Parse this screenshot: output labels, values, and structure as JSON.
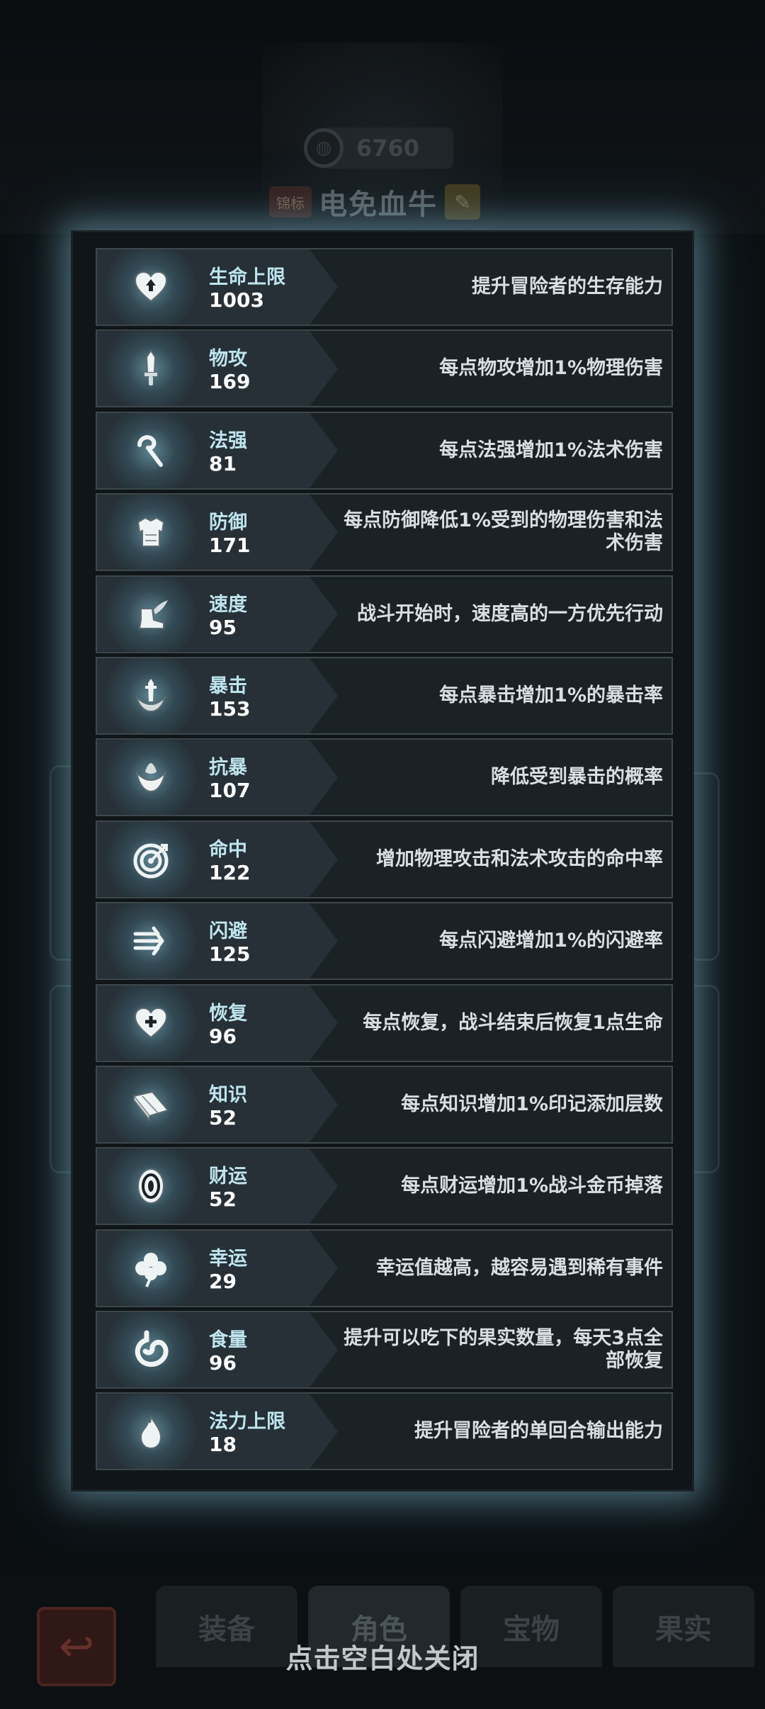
{
  "header": {
    "coin_value": "6760",
    "rank_badge": "锦标",
    "hero_name": "电免血牛"
  },
  "bottom_tabs": [
    {
      "label": "装备"
    },
    {
      "label": "角色"
    },
    {
      "label": "宝物"
    },
    {
      "label": "果实"
    }
  ],
  "stats": [
    {
      "name": "生命上限",
      "value": "1003",
      "desc": "提升冒险者的生存能力",
      "icon": "heart-up-icon"
    },
    {
      "name": "物攻",
      "value": "169",
      "desc": "每点物攻增加1%物理伤害",
      "icon": "sword-icon"
    },
    {
      "name": "法强",
      "value": "81",
      "desc": "每点法强增加1%法术伤害",
      "icon": "staff-icon"
    },
    {
      "name": "防御",
      "value": "171",
      "desc": "每点防御降低1%受到的物理伤害和法术伤害",
      "icon": "armor-icon"
    },
    {
      "name": "速度",
      "value": "95",
      "desc": "战斗开始时，速度高的一方优先行动",
      "icon": "winged-boot-icon"
    },
    {
      "name": "暴击",
      "value": "153",
      "desc": "每点暴击增加1%的暴击率",
      "icon": "crit-sword-icon"
    },
    {
      "name": "抗暴",
      "value": "107",
      "desc": "降低受到暴击的概率",
      "icon": "crit-resist-icon"
    },
    {
      "name": "命中",
      "value": "122",
      "desc": "增加物理攻击和法术攻击的命中率",
      "icon": "target-icon"
    },
    {
      "name": "闪避",
      "value": "125",
      "desc": "每点闪避增加1%的闪避率",
      "icon": "dodge-arrows-icon"
    },
    {
      "name": "恢复",
      "value": "96",
      "desc": "每点恢复，战斗结束后恢复1点生命",
      "icon": "heart-plus-icon"
    },
    {
      "name": "知识",
      "value": "52",
      "desc": "每点知识增加1%印记添加层数",
      "icon": "book-icon"
    },
    {
      "name": "财运",
      "value": "52",
      "desc": "每点财运增加1%战斗金币掉落",
      "icon": "coin-icon"
    },
    {
      "name": "幸运",
      "value": "29",
      "desc": "幸运值越高，越容易遇到稀有事件",
      "icon": "clover-icon"
    },
    {
      "name": "食量",
      "value": "96",
      "desc": "提升可以吃下的果实数量，每天3点全部恢复",
      "icon": "stomach-icon"
    },
    {
      "name": "法力上限",
      "value": "18",
      "desc": "提升冒险者的单回合输出能力",
      "icon": "mana-drop-icon"
    }
  ],
  "close_hint": "点击空白处关闭"
}
